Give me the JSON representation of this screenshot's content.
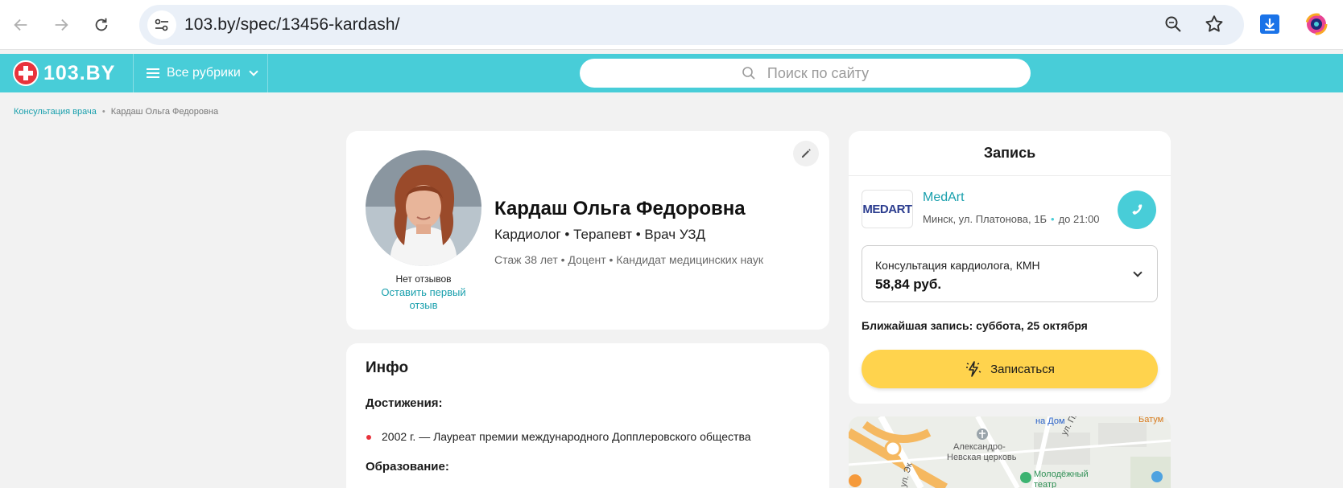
{
  "browser": {
    "url": "103.by/spec/13456-kardash/"
  },
  "site": {
    "logo_text": "103.BY",
    "rubrics_label": "Все рубрики",
    "search_placeholder": "Поиск по сайту"
  },
  "breadcrumb": {
    "items": [
      "Консультация врача",
      "Кардаш Ольга Федоровна"
    ]
  },
  "doctor": {
    "name": "Кардаш Ольга Федоровна",
    "specialties": "Кардиолог • Терапевт • Врач УЗД",
    "experience": "Стаж 38 лет  •  Доцент • Кандидат медицинских наук",
    "reviews_status": "Нет отзывов",
    "leave_review": "Оставить первый отзыв"
  },
  "info": {
    "title": "Инфо",
    "achievements_heading": "Достижения:",
    "achievements": [
      "2002 г. — Лауреат премии международного Допплеровского общества"
    ],
    "education_heading": "Образование:"
  },
  "booking": {
    "title": "Запись",
    "clinic_name": "MedArt",
    "clinic_logo": "MEDART",
    "clinic_address": "Минск, ул. Платонова, 1Б",
    "clinic_hours": "до 21:00",
    "service_name": "Консультация кардиолога, КМН",
    "service_price": "58,84 руб.",
    "nearest": "Ближайшая запись: суббота, 25 октября",
    "book_button": "Записаться"
  },
  "map": {
    "labels": [
      "на Дом",
      "Батум",
      "Александро-",
      "Невская церковь",
      "Молодёжный",
      "театр",
      "ул. Платонова",
      "ул. Эк"
    ]
  },
  "colors": {
    "brand_teal": "#48cdd8",
    "brand_red": "#e8333c",
    "book_yellow": "#ffd34d",
    "link_teal": "#1aa0ad"
  }
}
